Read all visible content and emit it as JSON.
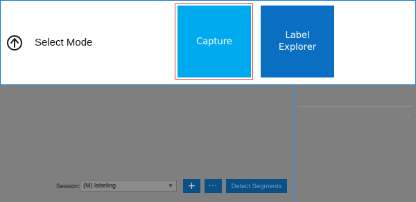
{
  "mode_panel": {
    "title": "Select Mode",
    "back_icon": "arrow-up-circle-icon",
    "tiles": [
      {
        "label": "Capture",
        "color": "#00aaef",
        "selected": true
      },
      {
        "label": "Label\nExplorer",
        "color": "#0a6fc2",
        "selected": false
      }
    ]
  },
  "workspace": {
    "session_label": "Session:",
    "session_value": "(M) labeling",
    "add_icon": "plus-icon",
    "more_label": "···",
    "detect_label": "Detect Segments"
  },
  "colors": {
    "accent": "#0a7bd6",
    "overlay": "#7f7f7f",
    "selection_outline": "#d93a3a"
  }
}
